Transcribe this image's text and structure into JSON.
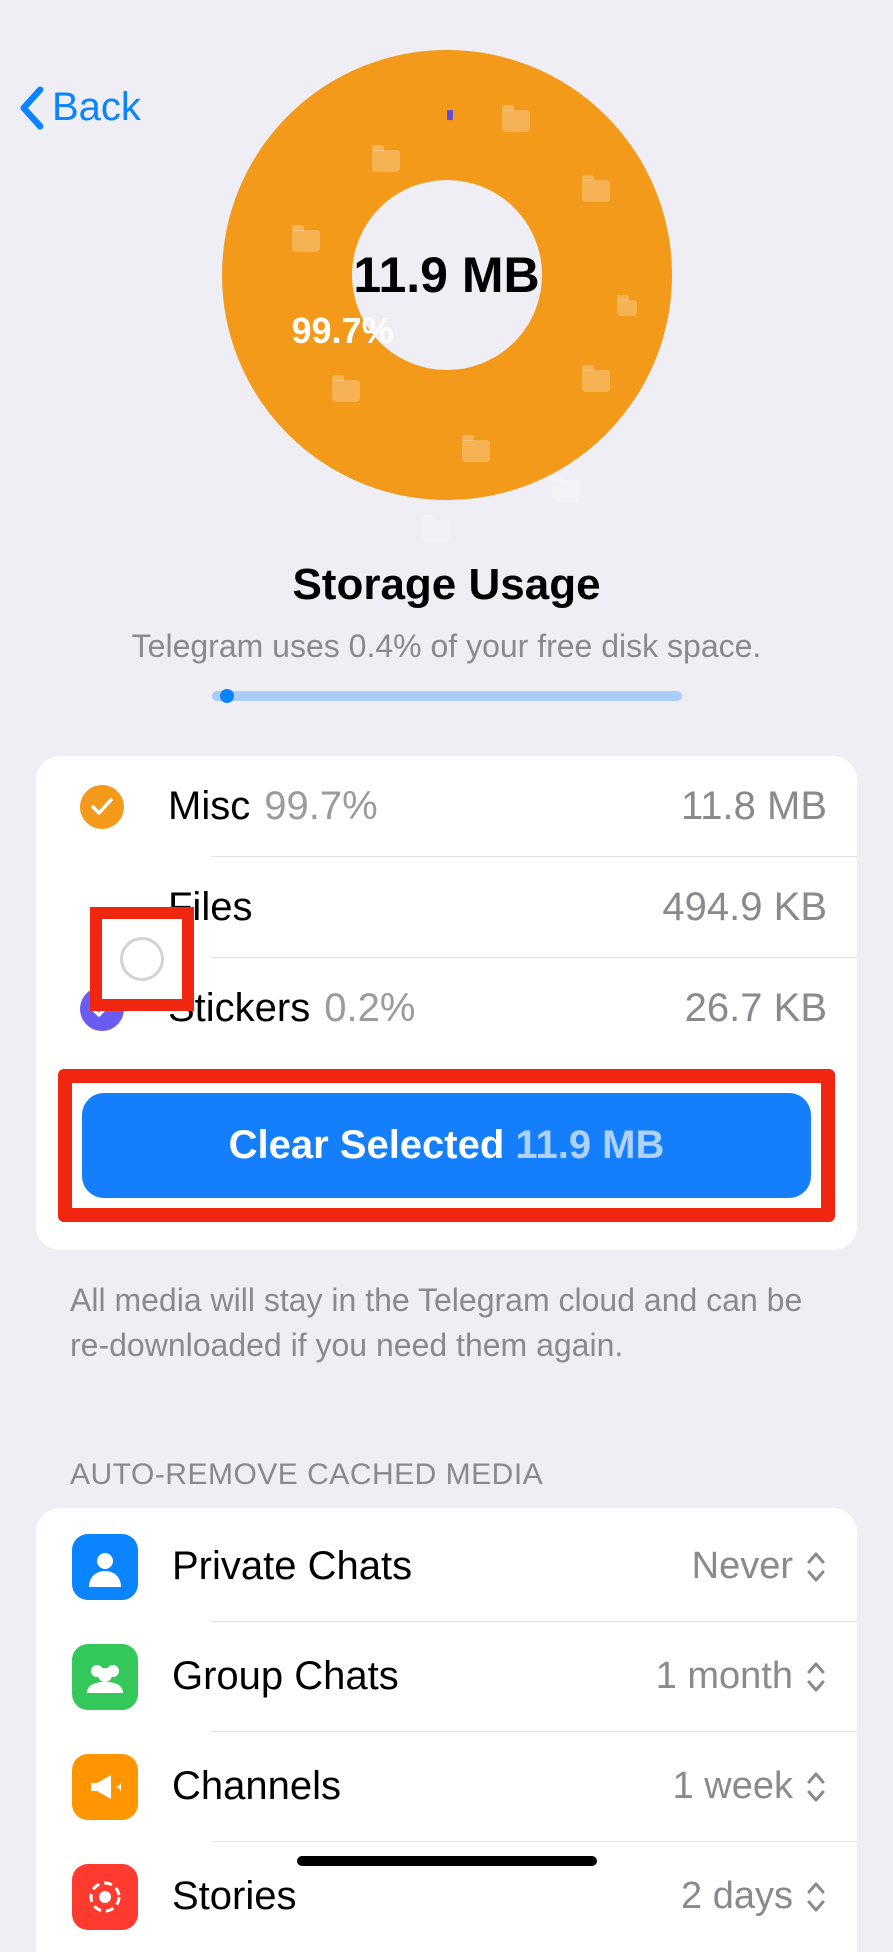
{
  "nav": {
    "back": "Back"
  },
  "chart_data": {
    "type": "pie",
    "title": "Storage Usage",
    "center_label": "11.9 MB",
    "series": [
      {
        "name": "Misc",
        "value": 99.7,
        "size": "11.8 MB",
        "color": "#f39a1b"
      },
      {
        "name": "Files",
        "value": 0.1,
        "size": "494.9 KB",
        "color": "#5c4fe0"
      },
      {
        "name": "Stickers",
        "value": 0.2,
        "size": "26.7 KB",
        "color": "#a9cdf7"
      }
    ],
    "dominant_label": "99.7%"
  },
  "header": {
    "title": "Storage Usage",
    "subtitle": "Telegram uses 0.4% of your free disk space."
  },
  "categories": [
    {
      "name": "Misc",
      "pct": "99.7%",
      "size": "11.8 MB",
      "checked": true,
      "color": "orange"
    },
    {
      "name": "Files",
      "pct": "",
      "size": "494.9 KB",
      "checked": false,
      "color": "empty"
    },
    {
      "name": "Stickers",
      "pct": "0.2%",
      "size": "26.7 KB",
      "checked": true,
      "color": "purple"
    }
  ],
  "clear_button": {
    "label": "Clear Selected",
    "amount": "11.9 MB"
  },
  "footer_note": "All media will stay in the Telegram cloud and can be re-downloaded if you need them again.",
  "auto_remove": {
    "header": "AUTO-REMOVE CACHED MEDIA",
    "rows": [
      {
        "label": "Private Chats",
        "value": "Never",
        "icon": "person",
        "color": "#0a84ff"
      },
      {
        "label": "Group Chats",
        "value": "1 month",
        "icon": "group",
        "color": "#34c759"
      },
      {
        "label": "Channels",
        "value": "1 week",
        "icon": "megaphone",
        "color": "#ff9500"
      },
      {
        "label": "Stories",
        "value": "2 days",
        "icon": "stories",
        "color": "#ff3b30"
      }
    ]
  }
}
